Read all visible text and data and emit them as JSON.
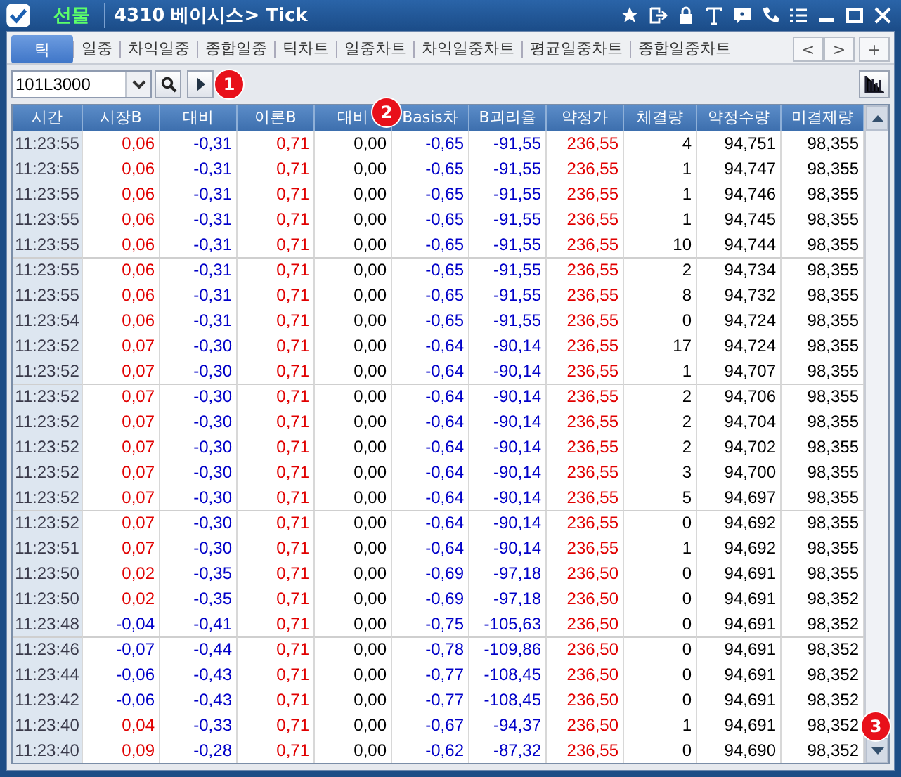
{
  "window": {
    "market": "선물",
    "title": "4310 베이시스> Tick"
  },
  "tabs": [
    {
      "label": "틱",
      "selected": true
    },
    {
      "label": "일중",
      "selected": false
    },
    {
      "label": "차익일중",
      "selected": false
    },
    {
      "label": "종합일중",
      "selected": false
    },
    {
      "label": "틱차트",
      "selected": false
    },
    {
      "label": "일중차트",
      "selected": false
    },
    {
      "label": "차익일중차트",
      "selected": false
    },
    {
      "label": "평균일중차트",
      "selected": false
    },
    {
      "label": "종합일중차트",
      "selected": false
    }
  ],
  "tab_nav": {
    "prev": "<",
    "next": ">",
    "add": "+"
  },
  "toolbar": {
    "code": "101L3000"
  },
  "markers": [
    "1",
    "2",
    "3"
  ],
  "table": {
    "columns": [
      {
        "label": "시간",
        "color": "#3a3a4a"
      },
      {
        "label": "시장B"
      },
      {
        "label": "대비",
        "color": "#0000c8"
      },
      {
        "label": "이론B",
        "color": "#e00000"
      },
      {
        "label": "대비",
        "color": "#000000"
      },
      {
        "label": "Basis차",
        "color": "#0000c8"
      },
      {
        "label": "B괴리율",
        "color": "#0000c8"
      },
      {
        "label": "약정가",
        "color": "#e00000"
      },
      {
        "label": "체결량",
        "color": "#000000"
      },
      {
        "label": "약정수량",
        "color": "#000000"
      },
      {
        "label": "미결제량",
        "color": "#000000"
      }
    ],
    "rows": [
      {
        "color": "#e00000",
        "cells": [
          "11:23:55",
          "0,06",
          "-0,31",
          "0,71",
          "0,00",
          "-0,65",
          "-91,55",
          "236,55",
          "4",
          "94,751",
          "98,355"
        ]
      },
      {
        "color": "#e00000",
        "cells": [
          "11:23:55",
          "0,06",
          "-0,31",
          "0,71",
          "0,00",
          "-0,65",
          "-91,55",
          "236,55",
          "1",
          "94,747",
          "98,355"
        ]
      },
      {
        "color": "#e00000",
        "cells": [
          "11:23:55",
          "0,06",
          "-0,31",
          "0,71",
          "0,00",
          "-0,65",
          "-91,55",
          "236,55",
          "1",
          "94,746",
          "98,355"
        ]
      },
      {
        "color": "#e00000",
        "cells": [
          "11:23:55",
          "0,06",
          "-0,31",
          "0,71",
          "0,00",
          "-0,65",
          "-91,55",
          "236,55",
          "1",
          "94,745",
          "98,355"
        ]
      },
      {
        "color": "#e00000",
        "cells": [
          "11:23:55",
          "0,06",
          "-0,31",
          "0,71",
          "0,00",
          "-0,65",
          "-91,55",
          "236,55",
          "10",
          "94,744",
          "98,355"
        ]
      },
      {
        "color": "#e00000",
        "cells": [
          "11:23:55",
          "0,06",
          "-0,31",
          "0,71",
          "0,00",
          "-0,65",
          "-91,55",
          "236,55",
          "2",
          "94,734",
          "98,355"
        ]
      },
      {
        "color": "#e00000",
        "cells": [
          "11:23:55",
          "0,06",
          "-0,31",
          "0,71",
          "0,00",
          "-0,65",
          "-91,55",
          "236,55",
          "8",
          "94,732",
          "98,355"
        ]
      },
      {
        "color": "#e00000",
        "cells": [
          "11:23:54",
          "0,06",
          "-0,31",
          "0,71",
          "0,00",
          "-0,65",
          "-91,55",
          "236,55",
          "0",
          "94,724",
          "98,355"
        ]
      },
      {
        "color": "#e00000",
        "cells": [
          "11:23:52",
          "0,07",
          "-0,30",
          "0,71",
          "0,00",
          "-0,64",
          "-90,14",
          "236,55",
          "17",
          "94,724",
          "98,355"
        ]
      },
      {
        "color": "#e00000",
        "cells": [
          "11:23:52",
          "0,07",
          "-0,30",
          "0,71",
          "0,00",
          "-0,64",
          "-90,14",
          "236,55",
          "1",
          "94,707",
          "98,355"
        ]
      },
      {
        "color": "#e00000",
        "cells": [
          "11:23:52",
          "0,07",
          "-0,30",
          "0,71",
          "0,00",
          "-0,64",
          "-90,14",
          "236,55",
          "2",
          "94,706",
          "98,355"
        ]
      },
      {
        "color": "#e00000",
        "cells": [
          "11:23:52",
          "0,07",
          "-0,30",
          "0,71",
          "0,00",
          "-0,64",
          "-90,14",
          "236,55",
          "2",
          "94,704",
          "98,355"
        ]
      },
      {
        "color": "#e00000",
        "cells": [
          "11:23:52",
          "0,07",
          "-0,30",
          "0,71",
          "0,00",
          "-0,64",
          "-90,14",
          "236,55",
          "2",
          "94,702",
          "98,355"
        ]
      },
      {
        "color": "#e00000",
        "cells": [
          "11:23:52",
          "0,07",
          "-0,30",
          "0,71",
          "0,00",
          "-0,64",
          "-90,14",
          "236,55",
          "3",
          "94,700",
          "98,355"
        ]
      },
      {
        "color": "#e00000",
        "cells": [
          "11:23:52",
          "0,07",
          "-0,30",
          "0,71",
          "0,00",
          "-0,64",
          "-90,14",
          "236,55",
          "5",
          "94,697",
          "98,355"
        ]
      },
      {
        "color": "#e00000",
        "cells": [
          "11:23:52",
          "0,07",
          "-0,30",
          "0,71",
          "0,00",
          "-0,64",
          "-90,14",
          "236,55",
          "0",
          "94,692",
          "98,355"
        ]
      },
      {
        "color": "#e00000",
        "cells": [
          "11:23:51",
          "0,07",
          "-0,30",
          "0,71",
          "0,00",
          "-0,64",
          "-90,14",
          "236,55",
          "1",
          "94,692",
          "98,355"
        ]
      },
      {
        "color": "#e00000",
        "cells": [
          "11:23:50",
          "0,02",
          "-0,35",
          "0,71",
          "0,00",
          "-0,69",
          "-97,18",
          "236,50",
          "0",
          "94,691",
          "98,355"
        ]
      },
      {
        "color": "#e00000",
        "cells": [
          "11:23:50",
          "0,02",
          "-0,35",
          "0,71",
          "0,00",
          "-0,69",
          "-97,18",
          "236,50",
          "0",
          "94,691",
          "98,352"
        ]
      },
      {
        "color": "#0000c8",
        "cells": [
          "11:23:48",
          "-0,04",
          "-0,41",
          "0,71",
          "0,00",
          "-0,75",
          "-105,63",
          "236,50",
          "0",
          "94,691",
          "98,352"
        ]
      },
      {
        "color": "#0000c8",
        "cells": [
          "11:23:46",
          "-0,07",
          "-0,44",
          "0,71",
          "0,00",
          "-0,78",
          "-109,86",
          "236,50",
          "0",
          "94,691",
          "98,352"
        ]
      },
      {
        "color": "#0000c8",
        "cells": [
          "11:23:44",
          "-0,06",
          "-0,43",
          "0,71",
          "0,00",
          "-0,77",
          "-108,45",
          "236,50",
          "0",
          "94,691",
          "98,352"
        ]
      },
      {
        "color": "#0000c8",
        "cells": [
          "11:23:42",
          "-0,06",
          "-0,43",
          "0,71",
          "0,00",
          "-0,77",
          "-108,45",
          "236,50",
          "0",
          "94,691",
          "98,352"
        ]
      },
      {
        "color": "#e00000",
        "cells": [
          "11:23:40",
          "0,04",
          "-0,33",
          "0,71",
          "0,00",
          "-0,67",
          "-94,37",
          "236,50",
          "1",
          "94,691",
          "98,352"
        ]
      },
      {
        "color": "#e00000",
        "cells": [
          "11:23:40",
          "0,09",
          "-0,28",
          "0,71",
          "0,00",
          "-0,62",
          "-87,32",
          "236,55",
          "0",
          "94,690",
          "98,352"
        ]
      }
    ]
  }
}
